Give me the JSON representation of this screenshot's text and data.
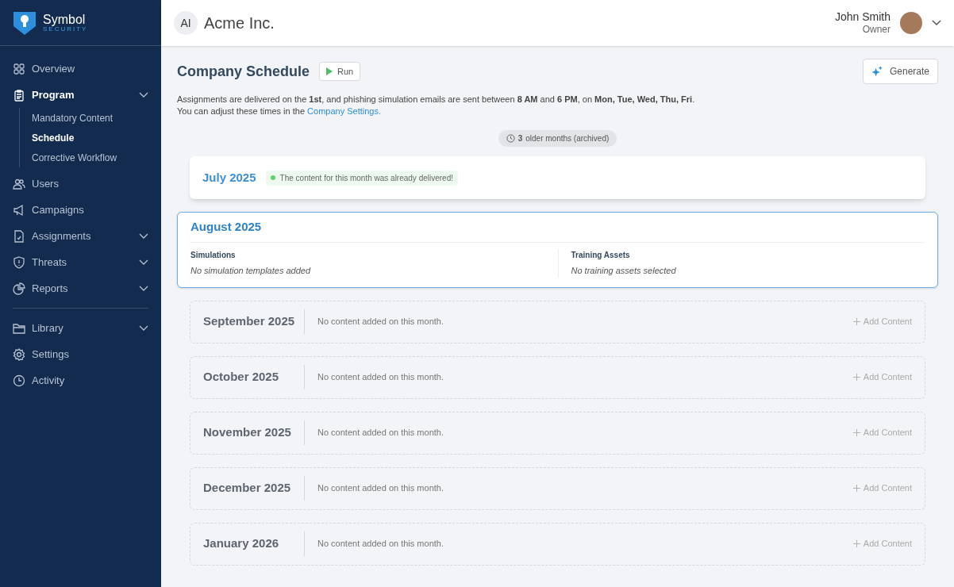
{
  "brand": {
    "name": "Symbol",
    "tagline": "SECURITY"
  },
  "sidebar": {
    "items": [
      {
        "label": "Overview",
        "selected": false,
        "expandable": false
      },
      {
        "label": "Program",
        "selected": true,
        "expandable": true,
        "children": [
          {
            "label": "Mandatory Content",
            "selected": false
          },
          {
            "label": "Schedule",
            "selected": true
          },
          {
            "label": "Corrective Workflow",
            "selected": false
          }
        ]
      },
      {
        "label": "Users",
        "selected": false,
        "expandable": false
      },
      {
        "label": "Campaigns",
        "selected": false,
        "expandable": false
      },
      {
        "label": "Assignments",
        "selected": false,
        "expandable": true
      },
      {
        "label": "Threats",
        "selected": false,
        "expandable": true
      },
      {
        "label": "Reports",
        "selected": false,
        "expandable": true
      }
    ],
    "bottom_items": [
      {
        "label": "Library",
        "selected": false,
        "expandable": true
      },
      {
        "label": "Settings",
        "selected": false,
        "expandable": false
      },
      {
        "label": "Activity",
        "selected": false,
        "expandable": false
      }
    ]
  },
  "header": {
    "company_initials": "AI",
    "company": "Acme Inc.",
    "user_name": "John Smith",
    "user_role": "Owner"
  },
  "page": {
    "title": "Company Schedule",
    "run_button": "Run",
    "generate_button": "Generate",
    "description": "Assignments are delivered on the **1st**, and phishing simulation emails are sent between **8 AM** and **6 PM**, on **Mon, Tue, Wed, Thu, Fri**.",
    "settings_prefix": "You can adjust these times in the",
    "settings_link": "Company Settings",
    "settings_suffix": ".",
    "archived_count": "3",
    "archived_label": "older months (archived)"
  },
  "months": [
    {
      "kind": "delivered",
      "title": "July 2025",
      "status": "The content for this month was already delivered!"
    },
    {
      "kind": "current",
      "title": "August 2025",
      "sections": [
        {
          "label": "Simulations",
          "value": "No simulation templates added"
        },
        {
          "label": "Training Assets",
          "value": "No training assets selected"
        }
      ]
    },
    {
      "kind": "empty",
      "title": "September 2025",
      "message": "No content added on this month.",
      "action": "Add Content"
    },
    {
      "kind": "empty",
      "title": "October 2025",
      "message": "No content added on this month.",
      "action": "Add Content"
    },
    {
      "kind": "empty",
      "title": "November 2025",
      "message": "No content added on this month.",
      "action": "Add Content"
    },
    {
      "kind": "empty",
      "title": "December 2025",
      "message": "No content added on this month.",
      "action": "Add Content"
    },
    {
      "kind": "empty",
      "title": "January 2026",
      "message": "No content added on this month.",
      "action": "Add Content"
    }
  ]
}
